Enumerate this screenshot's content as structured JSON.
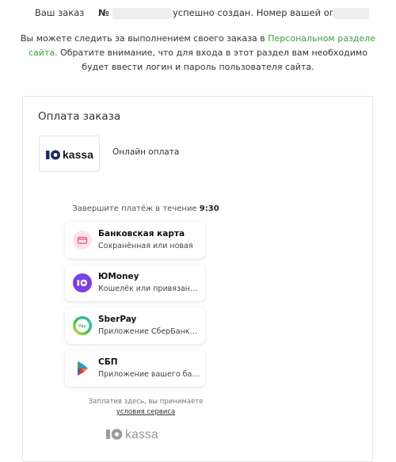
{
  "order": {
    "prefix": "Ваш заказ",
    "number_sign": "№",
    "created_text": "успешно создан. Номер вашей оплаты:"
  },
  "notice": {
    "before_link": "Вы можете следить за выполнением своего заказа в ",
    "link": "Персональном разделе сайта",
    "after_link": ". Обратите внимание, что для входа в этот раздел вам необходимо будет ввести логин и пароль пользователя сайта."
  },
  "payment": {
    "title": "Оплата заказа",
    "provider_logo_text": "kassa",
    "provider_label": "Онлайн оплата",
    "timer_prefix": "Завершите платёж в течение",
    "timer_value": "9:30",
    "methods": [
      {
        "title": "Банковская карта",
        "subtitle": "Сохранённая или новая",
        "icon": "bank-card-icon"
      },
      {
        "title": "ЮMoney",
        "subtitle": "Кошелёк или привязанная карта",
        "icon": "yoomoney-icon"
      },
      {
        "title": "SberPay",
        "subtitle": "Приложение СберБанк Онлайн",
        "icon": "sberpay-icon"
      },
      {
        "title": "СБП",
        "subtitle": "Приложение вашего банка",
        "icon": "sbp-icon"
      }
    ],
    "terms_text": "Заплатив здесь, вы принимаете",
    "terms_link": "условия сервиса",
    "footer_logo_text": "kassa"
  },
  "colors": {
    "link_green": "#3f9a3f",
    "yoomoney_purple": "#7b3fe4",
    "card_icon_bg": "#fbe3ea"
  }
}
